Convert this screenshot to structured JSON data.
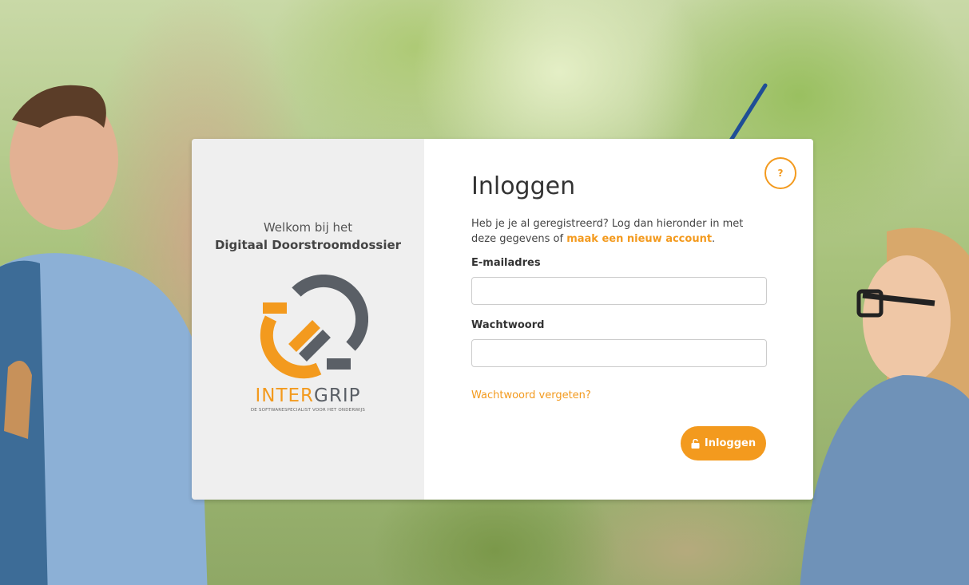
{
  "welcome": {
    "line1": "Welkom bij het",
    "line2": "Digitaal Doorstroomdossier"
  },
  "logo": {
    "word_inter": "INTER",
    "word_grip": "GRIP",
    "tagline": "DE SOFTWARESPECIALIST VOOR HET ONDERWIJS"
  },
  "login": {
    "title": "Inloggen",
    "help_label": "?",
    "intro_text": "Heb je je al geregistreerd? Log dan hieronder in met deze gegevens of ",
    "create_account_link": "maak een nieuw account",
    "intro_end": ".",
    "email_label": "E-mailadres",
    "email_value": "",
    "password_label": "Wachtwoord",
    "password_value": "",
    "forgot_link": "Wachtwoord vergeten?",
    "submit_label": "Inloggen"
  },
  "colors": {
    "accent": "#f39a1e",
    "logo_gray": "#5a5f66",
    "annotation_arrow": "#1f4e96"
  },
  "icons": {
    "help": "question-mark-icon",
    "submit": "unlock-icon",
    "annotation": "arrow-icon"
  }
}
